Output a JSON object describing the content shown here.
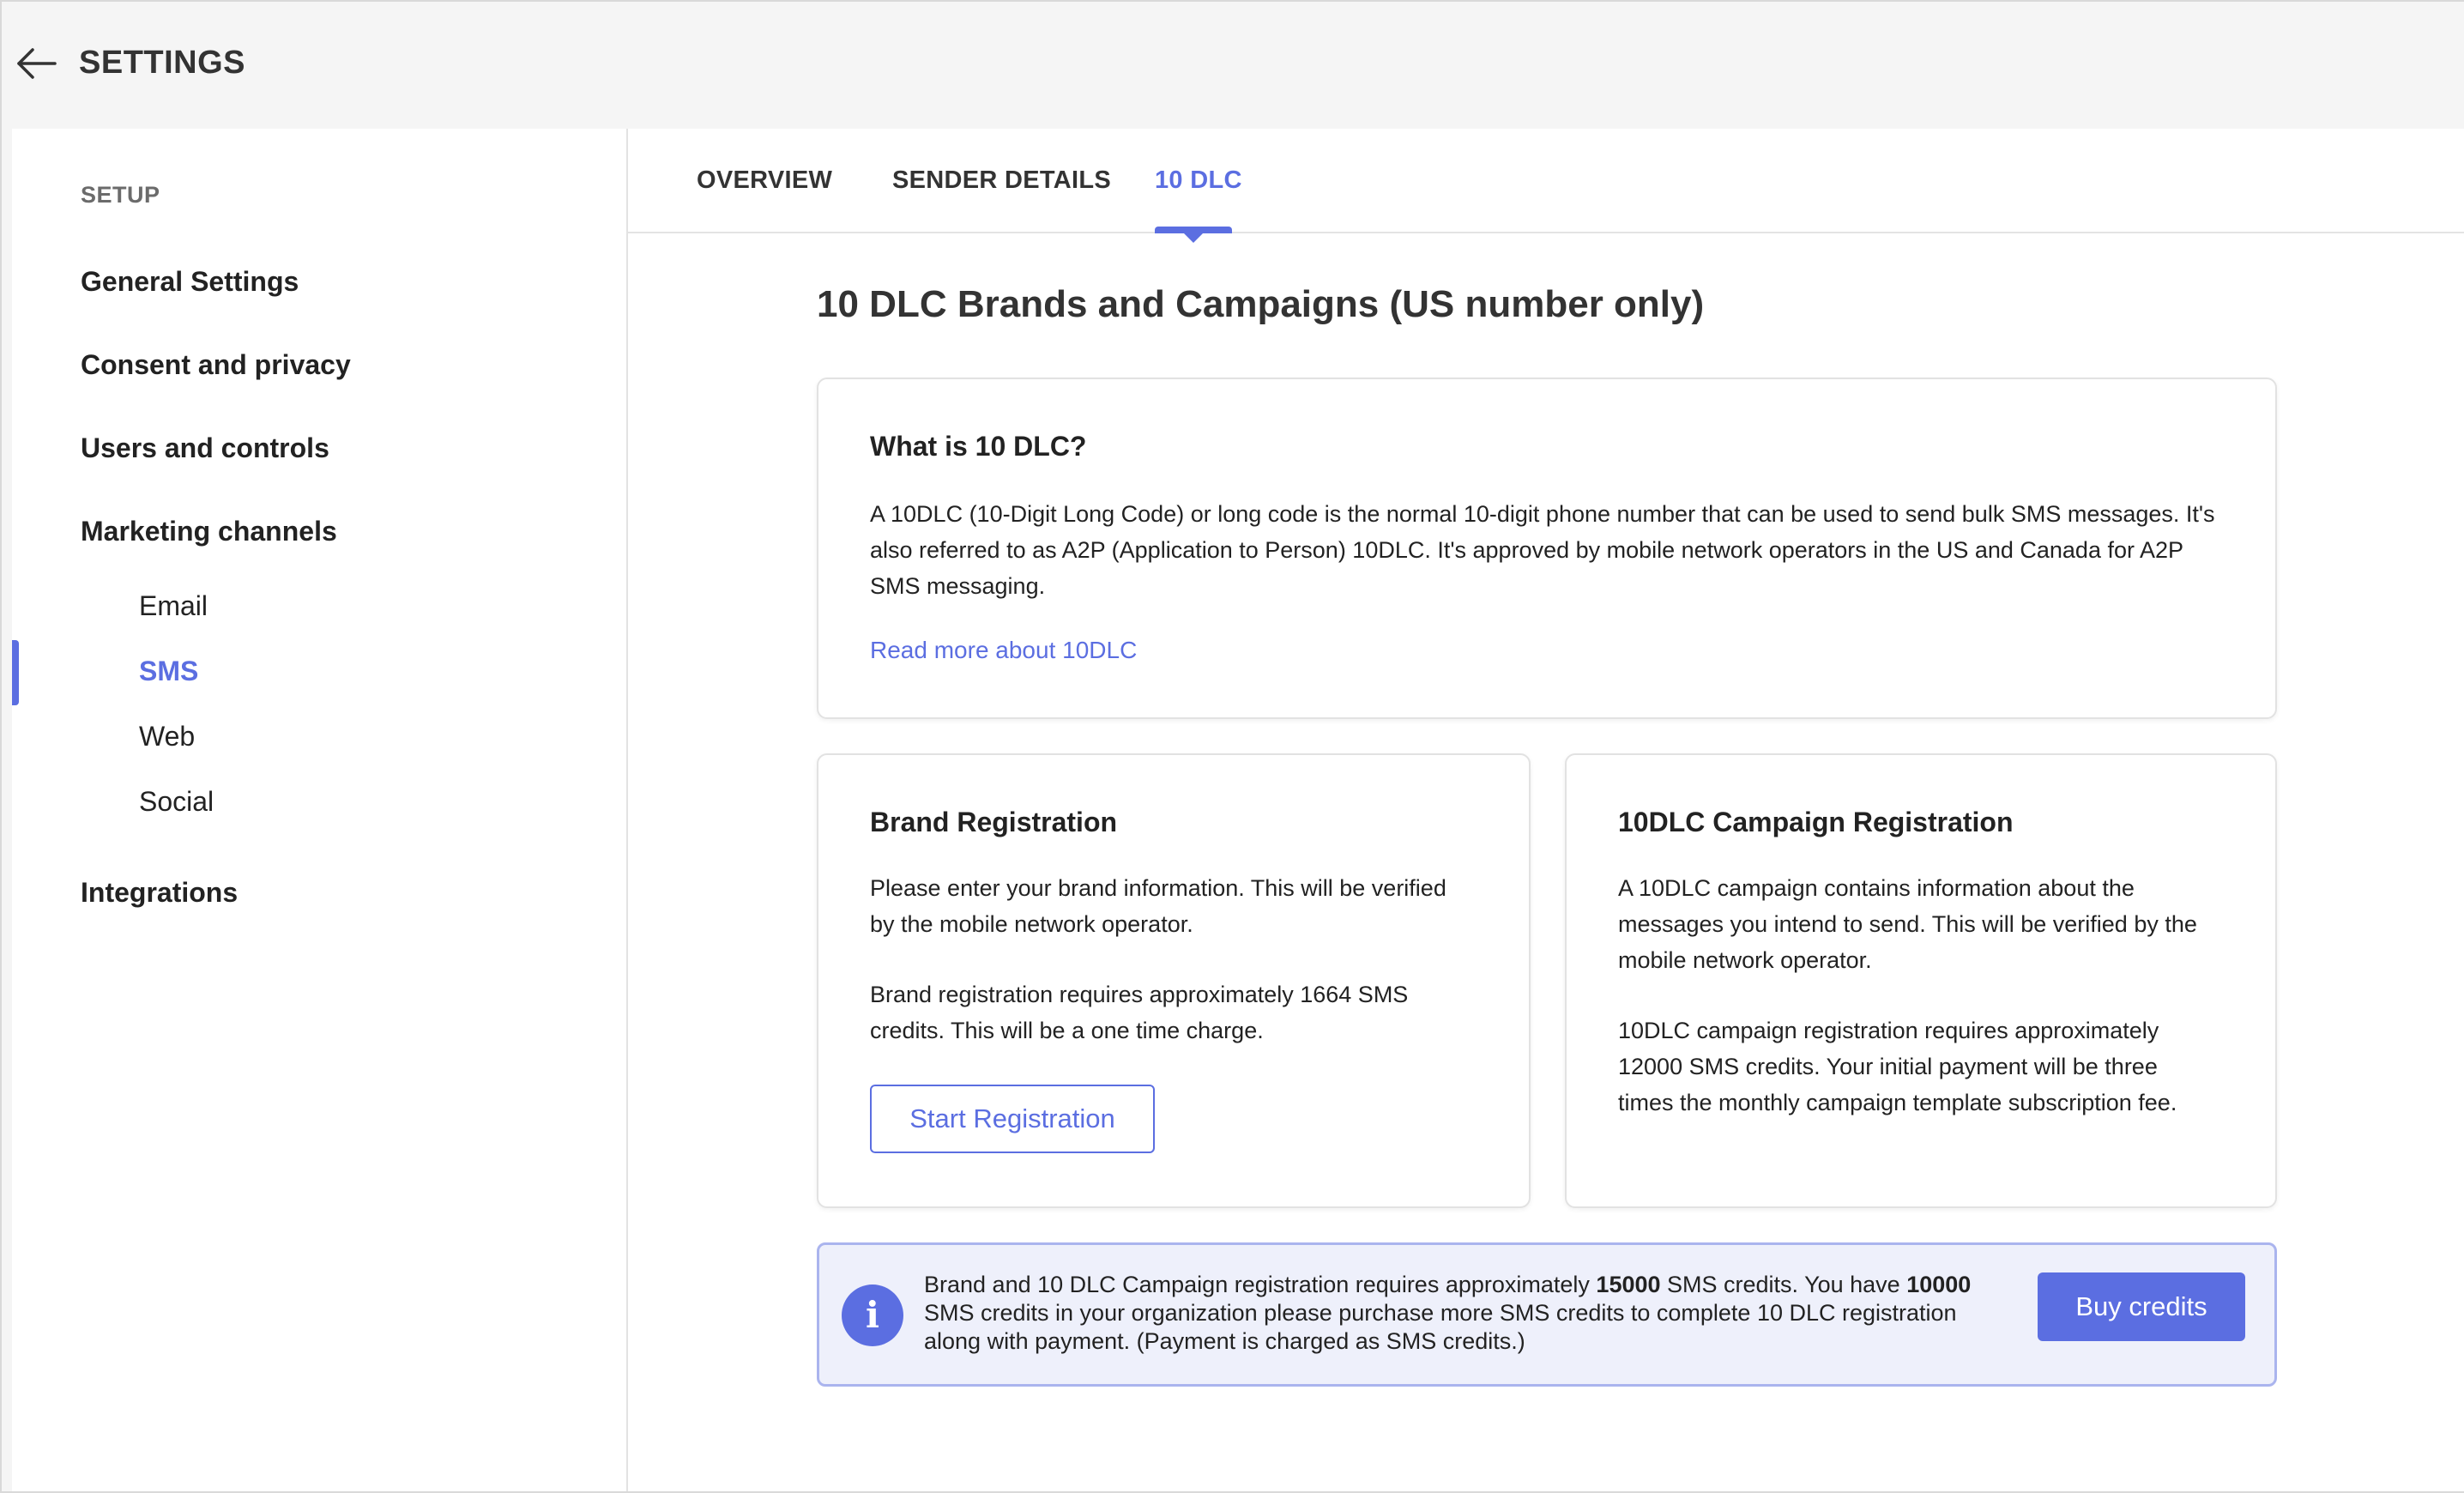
{
  "header": {
    "title": "SETTINGS"
  },
  "sidebar": {
    "section_label": "SETUP",
    "items": [
      {
        "label": "General Settings"
      },
      {
        "label": "Consent and privacy"
      },
      {
        "label": "Users and controls"
      },
      {
        "label": "Marketing channels"
      },
      {
        "label": "Integrations"
      }
    ],
    "sub_items": [
      {
        "label": "Email"
      },
      {
        "label": "SMS",
        "active": true
      },
      {
        "label": "Web"
      },
      {
        "label": "Social"
      }
    ]
  },
  "tabs": [
    {
      "label": "OVERVIEW"
    },
    {
      "label": "SENDER DETAILS"
    },
    {
      "label": "10 DLC",
      "active": true
    }
  ],
  "main": {
    "title": "10 DLC Brands and Campaigns (US number only)",
    "what_card": {
      "title": "What is 10 DLC?",
      "line1": "A 10DLC (10-Digit Long Code) or long code is the normal 10-digit phone number that can be used to send bulk SMS messages. It's",
      "line2": "also referred to as A2P (Application to Person) 10DLC. It's approved by mobile network operators in the US and Canada for A2P",
      "line3": "SMS messaging.",
      "link": "Read more about 10DLC"
    },
    "brand_card": {
      "title": "Brand Registration",
      "p1_line1": "Please enter your brand information. This will be verified",
      "p1_line2": "by the mobile network operator.",
      "p2_line1": "Brand registration requires approximately 1664 SMS",
      "p2_line2": "credits. This will be a one time charge.",
      "button": "Start Registration"
    },
    "campaign_card": {
      "title": "10DLC Campaign Registration",
      "p1_line1": "A 10DLC campaign contains information about the",
      "p1_line2": "messages you intend to send. This will be verified by the",
      "p1_line3": "mobile network operator.",
      "p2_line1": "10DLC campaign registration requires approximately",
      "p2_line2": "12000 SMS credits. Your initial payment will be three",
      "p2_line3": "times the monthly campaign template subscription fee."
    },
    "info": {
      "icon": "info-icon",
      "text_a": "Brand and 10 DLC Campaign registration requires approximately ",
      "required_credits": "15000",
      "text_b": " SMS credits. You have ",
      "available_credits": "10000",
      "text_c": " SMS credits in your organization please purchase more SMS credits to complete 10 DLC registration along with payment. (Payment is charged as SMS credits.)",
      "button": "Buy credits"
    }
  },
  "colors": {
    "accent": "#5b6ee1",
    "info_bg": "#eef0fb",
    "info_border": "#aab4ee"
  }
}
